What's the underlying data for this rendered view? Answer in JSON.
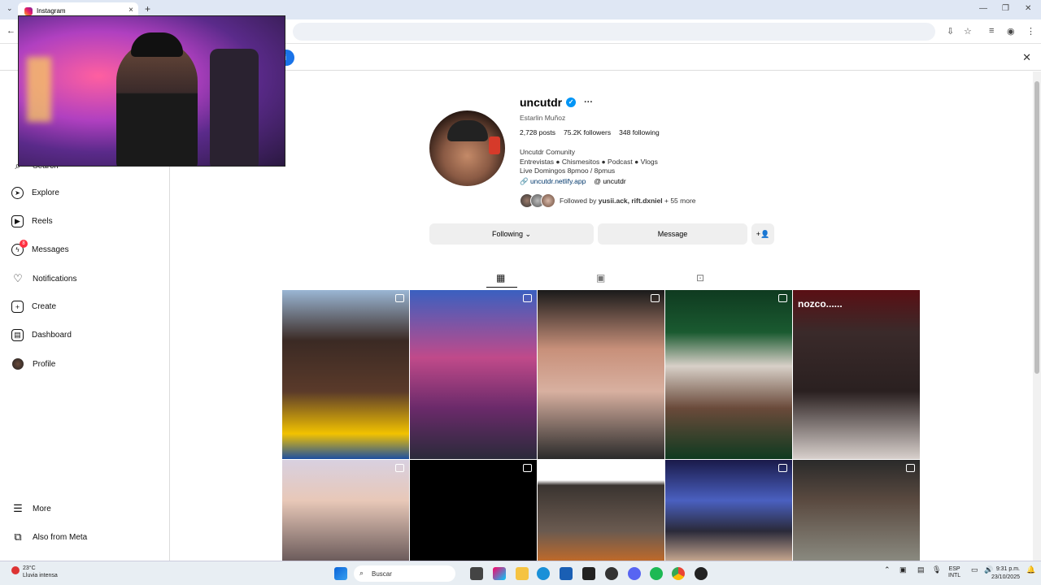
{
  "browser": {
    "tab_title": "Instagram",
    "tab_close": "×",
    "new_tab": "+",
    "tab_menu": "⌄",
    "back": "←",
    "win_min": "—",
    "win_max": "❐",
    "win_close": "✕",
    "infobar_close": "✕"
  },
  "sidebar": {
    "search": "Search",
    "explore": "Explore",
    "reels": "Reels",
    "messages": "Messages",
    "messages_badge": "8",
    "notifications": "Notifications",
    "create": "Create",
    "dashboard": "Dashboard",
    "profile": "Profile",
    "more": "More",
    "also_from_meta": "Also from Meta"
  },
  "profile": {
    "username": "uncutdr",
    "verified_mark": "✓",
    "options": "···",
    "full_name": "Estarlin Muñoz",
    "posts_count": "2,728",
    "posts_label": "posts",
    "followers_count": "75.2K",
    "followers_label": "followers",
    "following_count": "348",
    "following_label": "following",
    "bio_line1": "Uncutdr Comunity",
    "bio_line2": "Entrevistas ● Chismesitos ● Podcast ● Vlogs",
    "bio_line3": "Live Domingos 8pmoo / 8pmus",
    "link": "uncutdr.netlify.app",
    "threads": "uncutdr",
    "followed_by_prefix": "Followed by",
    "followed_by_names": "yusii.ack, rift.dxniel",
    "followed_by_more": "+ 55 more"
  },
  "actions": {
    "following": "Following ⌄",
    "message": "Message",
    "add_user": "+👤"
  },
  "grid": {
    "overlay_text": "nozco......"
  },
  "taskbar": {
    "temperature": "23°C",
    "weather": "Lluvia intensa",
    "search_placeholder": "Buscar",
    "lang_top": "ESP",
    "lang_bottom": "INTL",
    "time": "9:31 p.m.",
    "date": "23/10/2025"
  }
}
